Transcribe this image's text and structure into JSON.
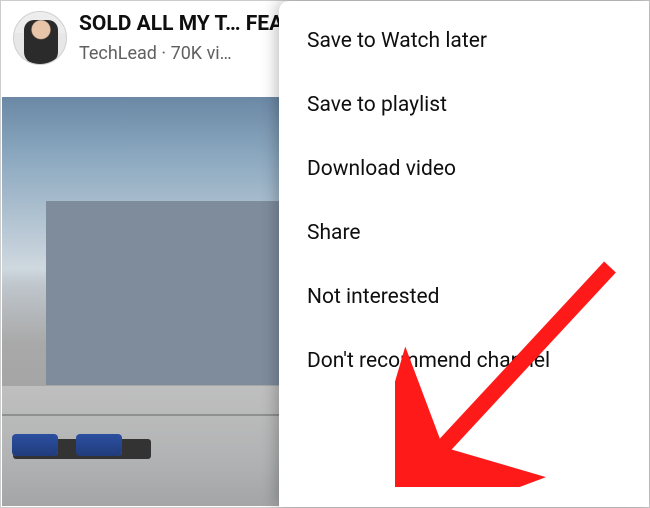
{
  "video": {
    "title": "SOLD ALL MY T… FEARS THE BIT…",
    "channel": "TechLead",
    "meta_separator": " · ",
    "views": "70K vi…"
  },
  "menu": {
    "items": [
      {
        "id": "watch-later",
        "label": "Save to Watch later"
      },
      {
        "id": "save-playlist",
        "label": "Save to playlist"
      },
      {
        "id": "download",
        "label": "Download video"
      },
      {
        "id": "share",
        "label": "Share"
      },
      {
        "id": "not-interested",
        "label": "Not interested"
      },
      {
        "id": "dont-recommend",
        "label": "Don't recommend channel"
      }
    ]
  },
  "annotation": {
    "arrow_color": "#ff1a1a"
  }
}
